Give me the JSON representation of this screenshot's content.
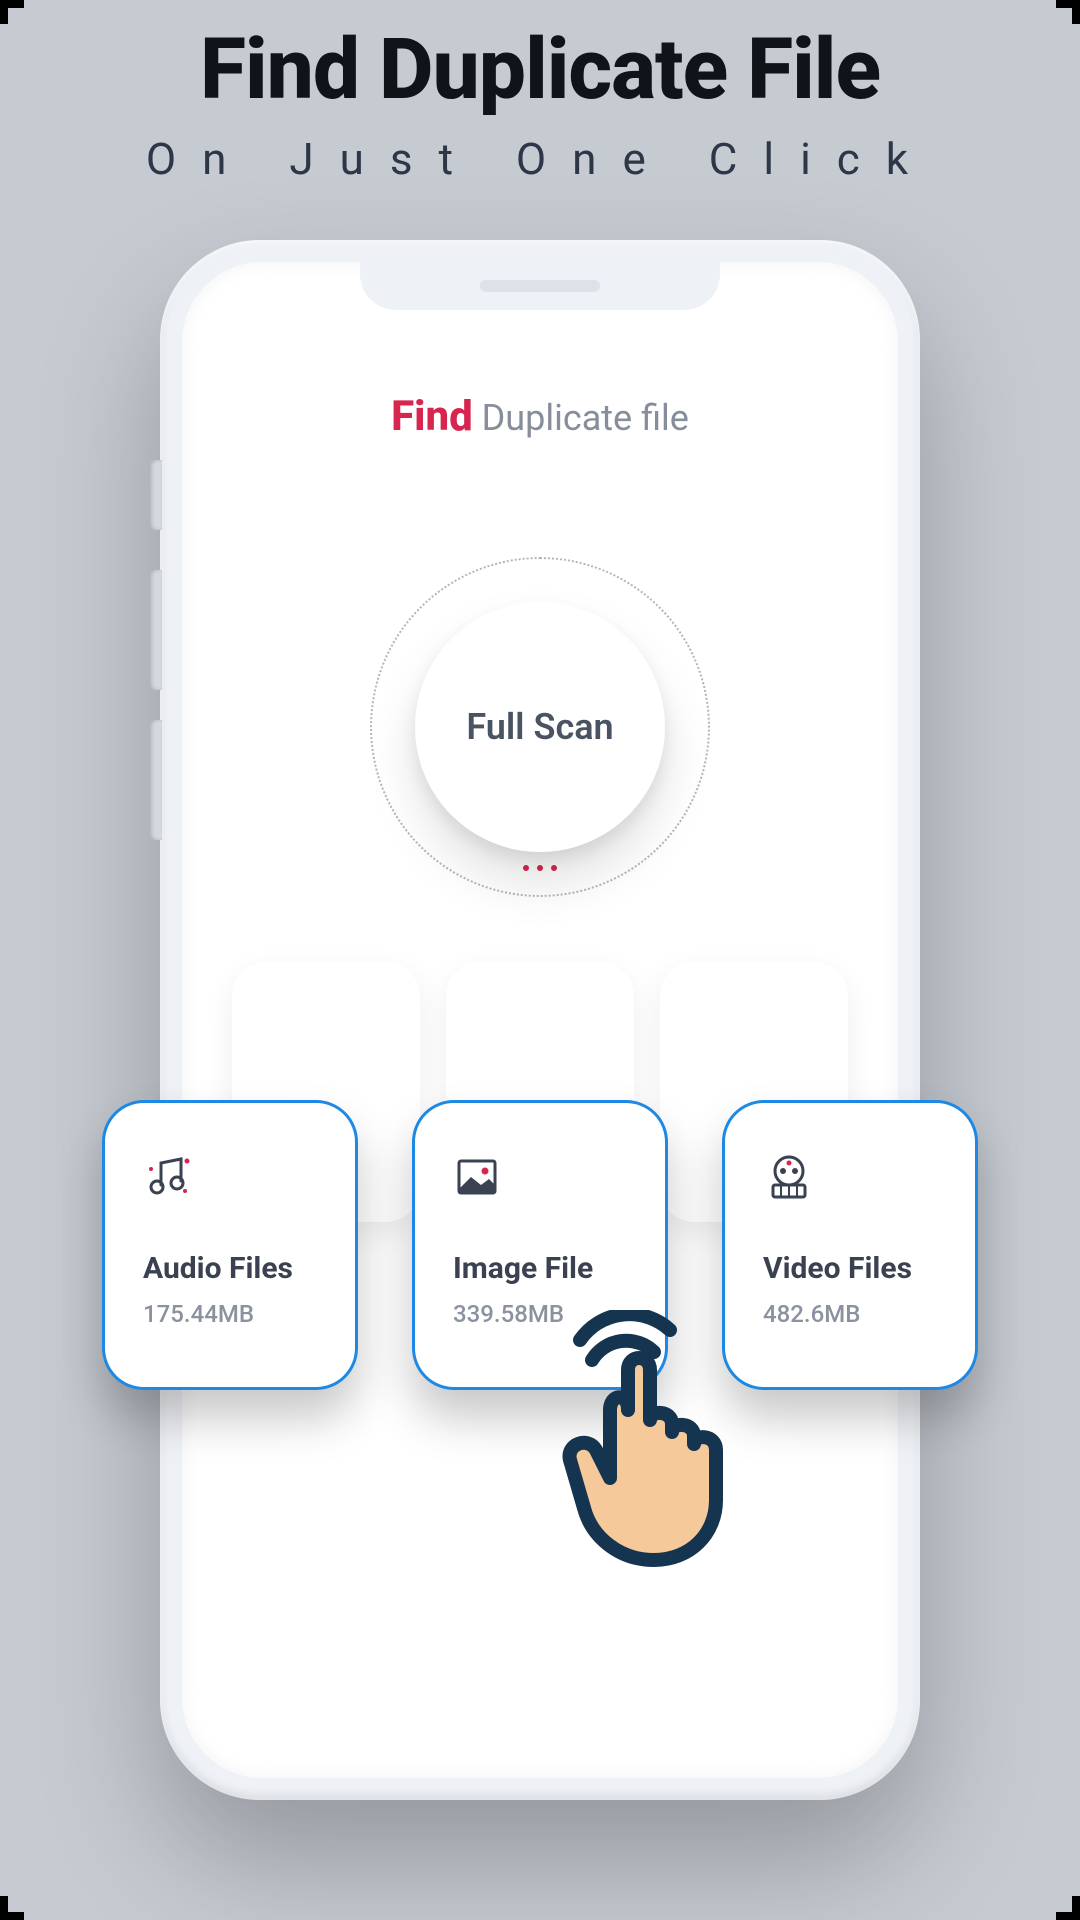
{
  "headline": {
    "title": "Find Duplicate File",
    "subtitle": "On Just One Click"
  },
  "app": {
    "brand": "Find",
    "suffix": "Duplicate file"
  },
  "scan": {
    "label": "Full Scan"
  },
  "categories": [
    {
      "icon": "music-icon",
      "title": "Audio Files",
      "size": "175.44MB"
    },
    {
      "icon": "image-icon",
      "title": "Image File",
      "size": "339.58MB"
    },
    {
      "icon": "video-icon",
      "title": "Video Files",
      "size": "482.6MB"
    }
  ]
}
